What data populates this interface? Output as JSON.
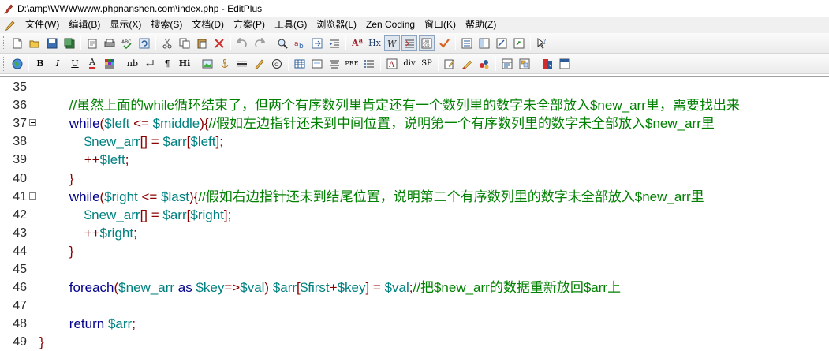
{
  "window": {
    "title": "D:\\amp\\WWW\\www.phpnanshen.com\\index.php - EditPlus"
  },
  "menu": [
    "文件(W)",
    "编辑(B)",
    "显示(X)",
    "搜索(S)",
    "文档(D)",
    "方案(P)",
    "工具(G)",
    "浏览器(L)",
    "Zen Coding",
    "窗口(K)",
    "帮助(Z)"
  ],
  "toolbar2_labels": {
    "bold": "B",
    "italic": "I",
    "underline": "U",
    "font_color": "A",
    "nb": "nb",
    "para": "¶",
    "hi": "Hi",
    "pre": "PRE",
    "div": "div",
    "sp": "SP",
    "hx": "Hx",
    "aa": "Aª"
  },
  "editor": {
    "lines": [
      {
        "n": "35",
        "fold": false,
        "segments": []
      },
      {
        "n": "36",
        "fold": false,
        "segments": [
          {
            "t": "        ",
            "c": "c-plain"
          },
          {
            "t": "//虽然上面的while循环结束了，但两个有序数列里肯定还有一个数列里的数字未全部放入$new_arr里，需要找出来",
            "c": "c-comment"
          }
        ]
      },
      {
        "n": "37",
        "fold": true,
        "segments": [
          {
            "t": "        ",
            "c": "c-plain"
          },
          {
            "t": "while",
            "c": "c-kw"
          },
          {
            "t": "(",
            "c": "c-op"
          },
          {
            "t": "$left",
            "c": "c-var"
          },
          {
            "t": " <= ",
            "c": "c-op"
          },
          {
            "t": "$middle",
            "c": "c-var"
          },
          {
            "t": "){",
            "c": "c-op"
          },
          {
            "t": "//假如左边指针还未到中间位置，说明第一个有序数列里的数字未全部放入$new_arr里",
            "c": "c-comment"
          }
        ]
      },
      {
        "n": "38",
        "fold": false,
        "segments": [
          {
            "t": "            ",
            "c": "c-plain"
          },
          {
            "t": "$new_arr",
            "c": "c-var"
          },
          {
            "t": "[] = ",
            "c": "c-op"
          },
          {
            "t": "$arr",
            "c": "c-var"
          },
          {
            "t": "[",
            "c": "c-op"
          },
          {
            "t": "$left",
            "c": "c-var"
          },
          {
            "t": "];",
            "c": "c-op"
          }
        ]
      },
      {
        "n": "39",
        "fold": false,
        "segments": [
          {
            "t": "            ",
            "c": "c-plain"
          },
          {
            "t": "++",
            "c": "c-op"
          },
          {
            "t": "$left",
            "c": "c-var"
          },
          {
            "t": ";",
            "c": "c-op"
          }
        ]
      },
      {
        "n": "40",
        "fold": false,
        "segments": [
          {
            "t": "        ",
            "c": "c-plain"
          },
          {
            "t": "}",
            "c": "c-op"
          }
        ]
      },
      {
        "n": "41",
        "fold": true,
        "segments": [
          {
            "t": "        ",
            "c": "c-plain"
          },
          {
            "t": "while",
            "c": "c-kw"
          },
          {
            "t": "(",
            "c": "c-op"
          },
          {
            "t": "$right",
            "c": "c-var"
          },
          {
            "t": " <= ",
            "c": "c-op"
          },
          {
            "t": "$last",
            "c": "c-var"
          },
          {
            "t": "){",
            "c": "c-op"
          },
          {
            "t": "//假如右边指针还未到结尾位置，说明第二个有序数列里的数字未全部放入$new_arr里",
            "c": "c-comment"
          }
        ]
      },
      {
        "n": "42",
        "fold": false,
        "segments": [
          {
            "t": "            ",
            "c": "c-plain"
          },
          {
            "t": "$new_arr",
            "c": "c-var"
          },
          {
            "t": "[] = ",
            "c": "c-op"
          },
          {
            "t": "$arr",
            "c": "c-var"
          },
          {
            "t": "[",
            "c": "c-op"
          },
          {
            "t": "$right",
            "c": "c-var"
          },
          {
            "t": "];",
            "c": "c-op"
          }
        ]
      },
      {
        "n": "43",
        "fold": false,
        "segments": [
          {
            "t": "            ",
            "c": "c-plain"
          },
          {
            "t": "++",
            "c": "c-op"
          },
          {
            "t": "$right",
            "c": "c-var"
          },
          {
            "t": ";",
            "c": "c-op"
          }
        ]
      },
      {
        "n": "44",
        "fold": false,
        "segments": [
          {
            "t": "        ",
            "c": "c-plain"
          },
          {
            "t": "}",
            "c": "c-op"
          }
        ]
      },
      {
        "n": "45",
        "fold": false,
        "segments": []
      },
      {
        "n": "46",
        "fold": false,
        "segments": [
          {
            "t": "        ",
            "c": "c-plain"
          },
          {
            "t": "foreach",
            "c": "c-kw"
          },
          {
            "t": "(",
            "c": "c-op"
          },
          {
            "t": "$new_arr",
            "c": "c-var"
          },
          {
            "t": " as ",
            "c": "c-kw"
          },
          {
            "t": "$key",
            "c": "c-var"
          },
          {
            "t": "=>",
            "c": "c-op"
          },
          {
            "t": "$val",
            "c": "c-var"
          },
          {
            "t": ") ",
            "c": "c-op"
          },
          {
            "t": "$arr",
            "c": "c-var"
          },
          {
            "t": "[",
            "c": "c-op"
          },
          {
            "t": "$first",
            "c": "c-var"
          },
          {
            "t": "+",
            "c": "c-op"
          },
          {
            "t": "$key",
            "c": "c-var"
          },
          {
            "t": "] = ",
            "c": "c-op"
          },
          {
            "t": "$val",
            "c": "c-var"
          },
          {
            "t": ";",
            "c": "c-op"
          },
          {
            "t": "//把$new_arr的数据重新放回$arr上",
            "c": "c-comment"
          }
        ]
      },
      {
        "n": "47",
        "fold": false,
        "segments": []
      },
      {
        "n": "48",
        "fold": false,
        "segments": [
          {
            "t": "        ",
            "c": "c-plain"
          },
          {
            "t": "return",
            "c": "c-kw"
          },
          {
            "t": " ",
            "c": "c-plain"
          },
          {
            "t": "$arr",
            "c": "c-var"
          },
          {
            "t": ";",
            "c": "c-op"
          }
        ]
      },
      {
        "n": "49",
        "fold": false,
        "segments": [
          {
            "t": "}",
            "c": "c-op"
          }
        ]
      }
    ]
  }
}
